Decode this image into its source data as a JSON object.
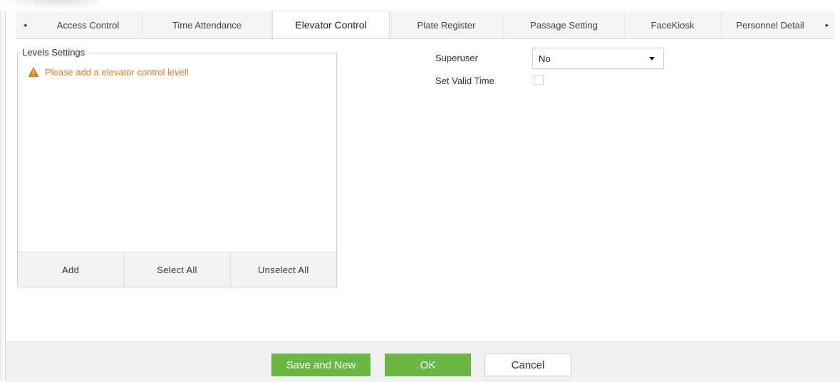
{
  "tabs": {
    "scroll_left": "◂",
    "scroll_right": "▸",
    "items": [
      {
        "label": "Access Control"
      },
      {
        "label": "Time Attendance"
      },
      {
        "label": "Elevator Control"
      },
      {
        "label": "Plate Register"
      },
      {
        "label": "Passage Setting"
      },
      {
        "label": "FaceKiosk"
      },
      {
        "label": "Personnel Detail"
      }
    ],
    "active_index": 2
  },
  "levels": {
    "legend": "Levels Settings",
    "warning": "Please add a elevator control level!",
    "warning_icon": "warning-triangle-icon",
    "warning_color": "#e57a17",
    "buttons": {
      "add": "Add",
      "select_all": "Select All",
      "unselect_all": "Unselect All"
    }
  },
  "form": {
    "superuser_label": "Superuser",
    "superuser_value": "No",
    "valid_time_label": "Set Valid Time",
    "valid_time_checked": false
  },
  "footer": {
    "save_new": "Save and New",
    "ok": "OK",
    "cancel": "Cancel",
    "accent": "#6ab743"
  }
}
